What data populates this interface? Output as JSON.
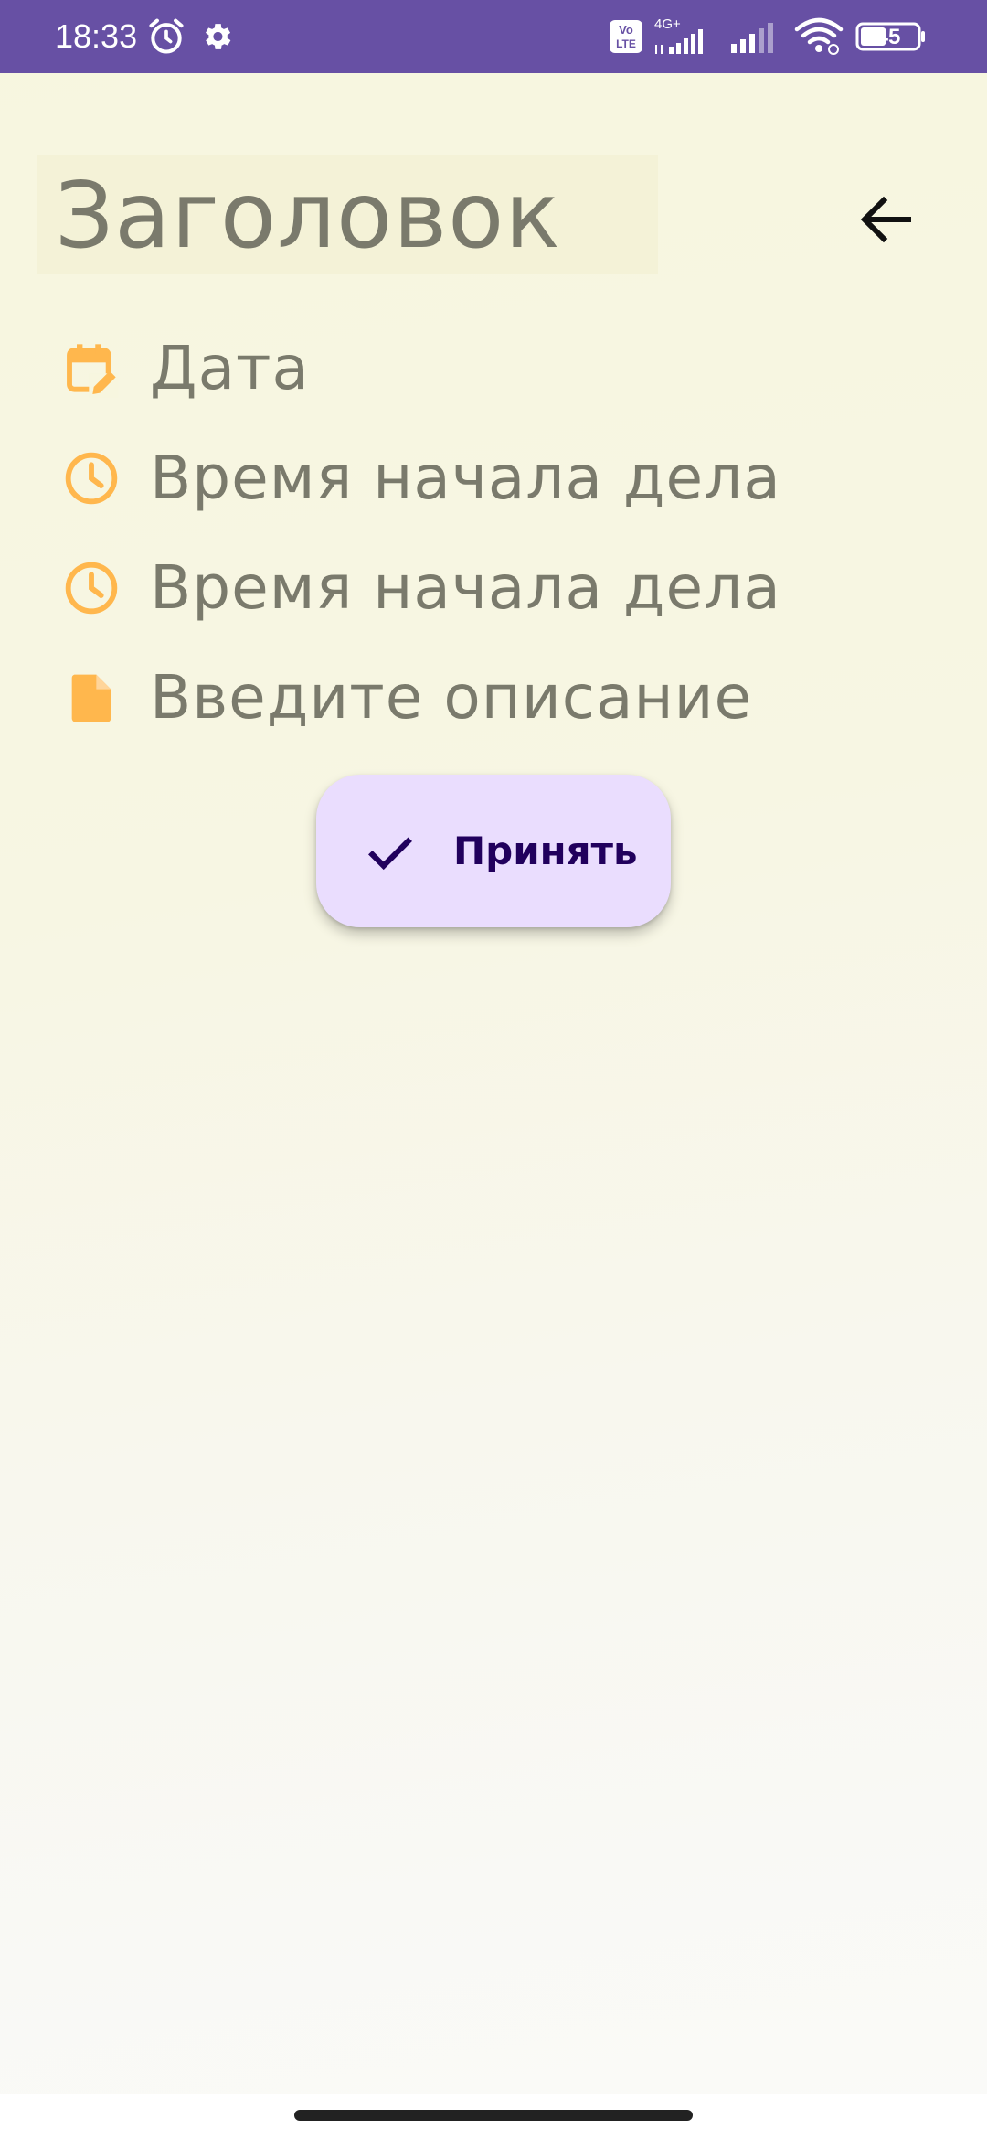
{
  "status_bar": {
    "time": "18:33",
    "battery": "45",
    "icons": [
      "alarm-icon",
      "settings-icon",
      "volte-icon",
      "signal-4g-icon",
      "signal-icon",
      "wifi-icon",
      "battery-icon"
    ],
    "volte_top": "Vo",
    "volte_bottom": "LTE",
    "network": "4G+"
  },
  "header": {
    "title_placeholder": "Заголовок",
    "back_icon": "arrow-back-icon"
  },
  "fields": [
    {
      "icon": "calendar-edit-icon",
      "label": "Дата"
    },
    {
      "icon": "clock-icon",
      "label": "Время начала дела"
    },
    {
      "icon": "clock-icon",
      "label": "Время начала дела"
    },
    {
      "icon": "document-icon",
      "label": "Введите описание"
    }
  ],
  "accept_button": {
    "label": "Принять",
    "icon": "check-icon"
  },
  "colors": {
    "status_bar": "#6750a4",
    "icon_accent": "#ffb74d",
    "text_muted": "#7a7a6c",
    "button_bg": "#eaddfe",
    "button_text": "#21005d"
  }
}
